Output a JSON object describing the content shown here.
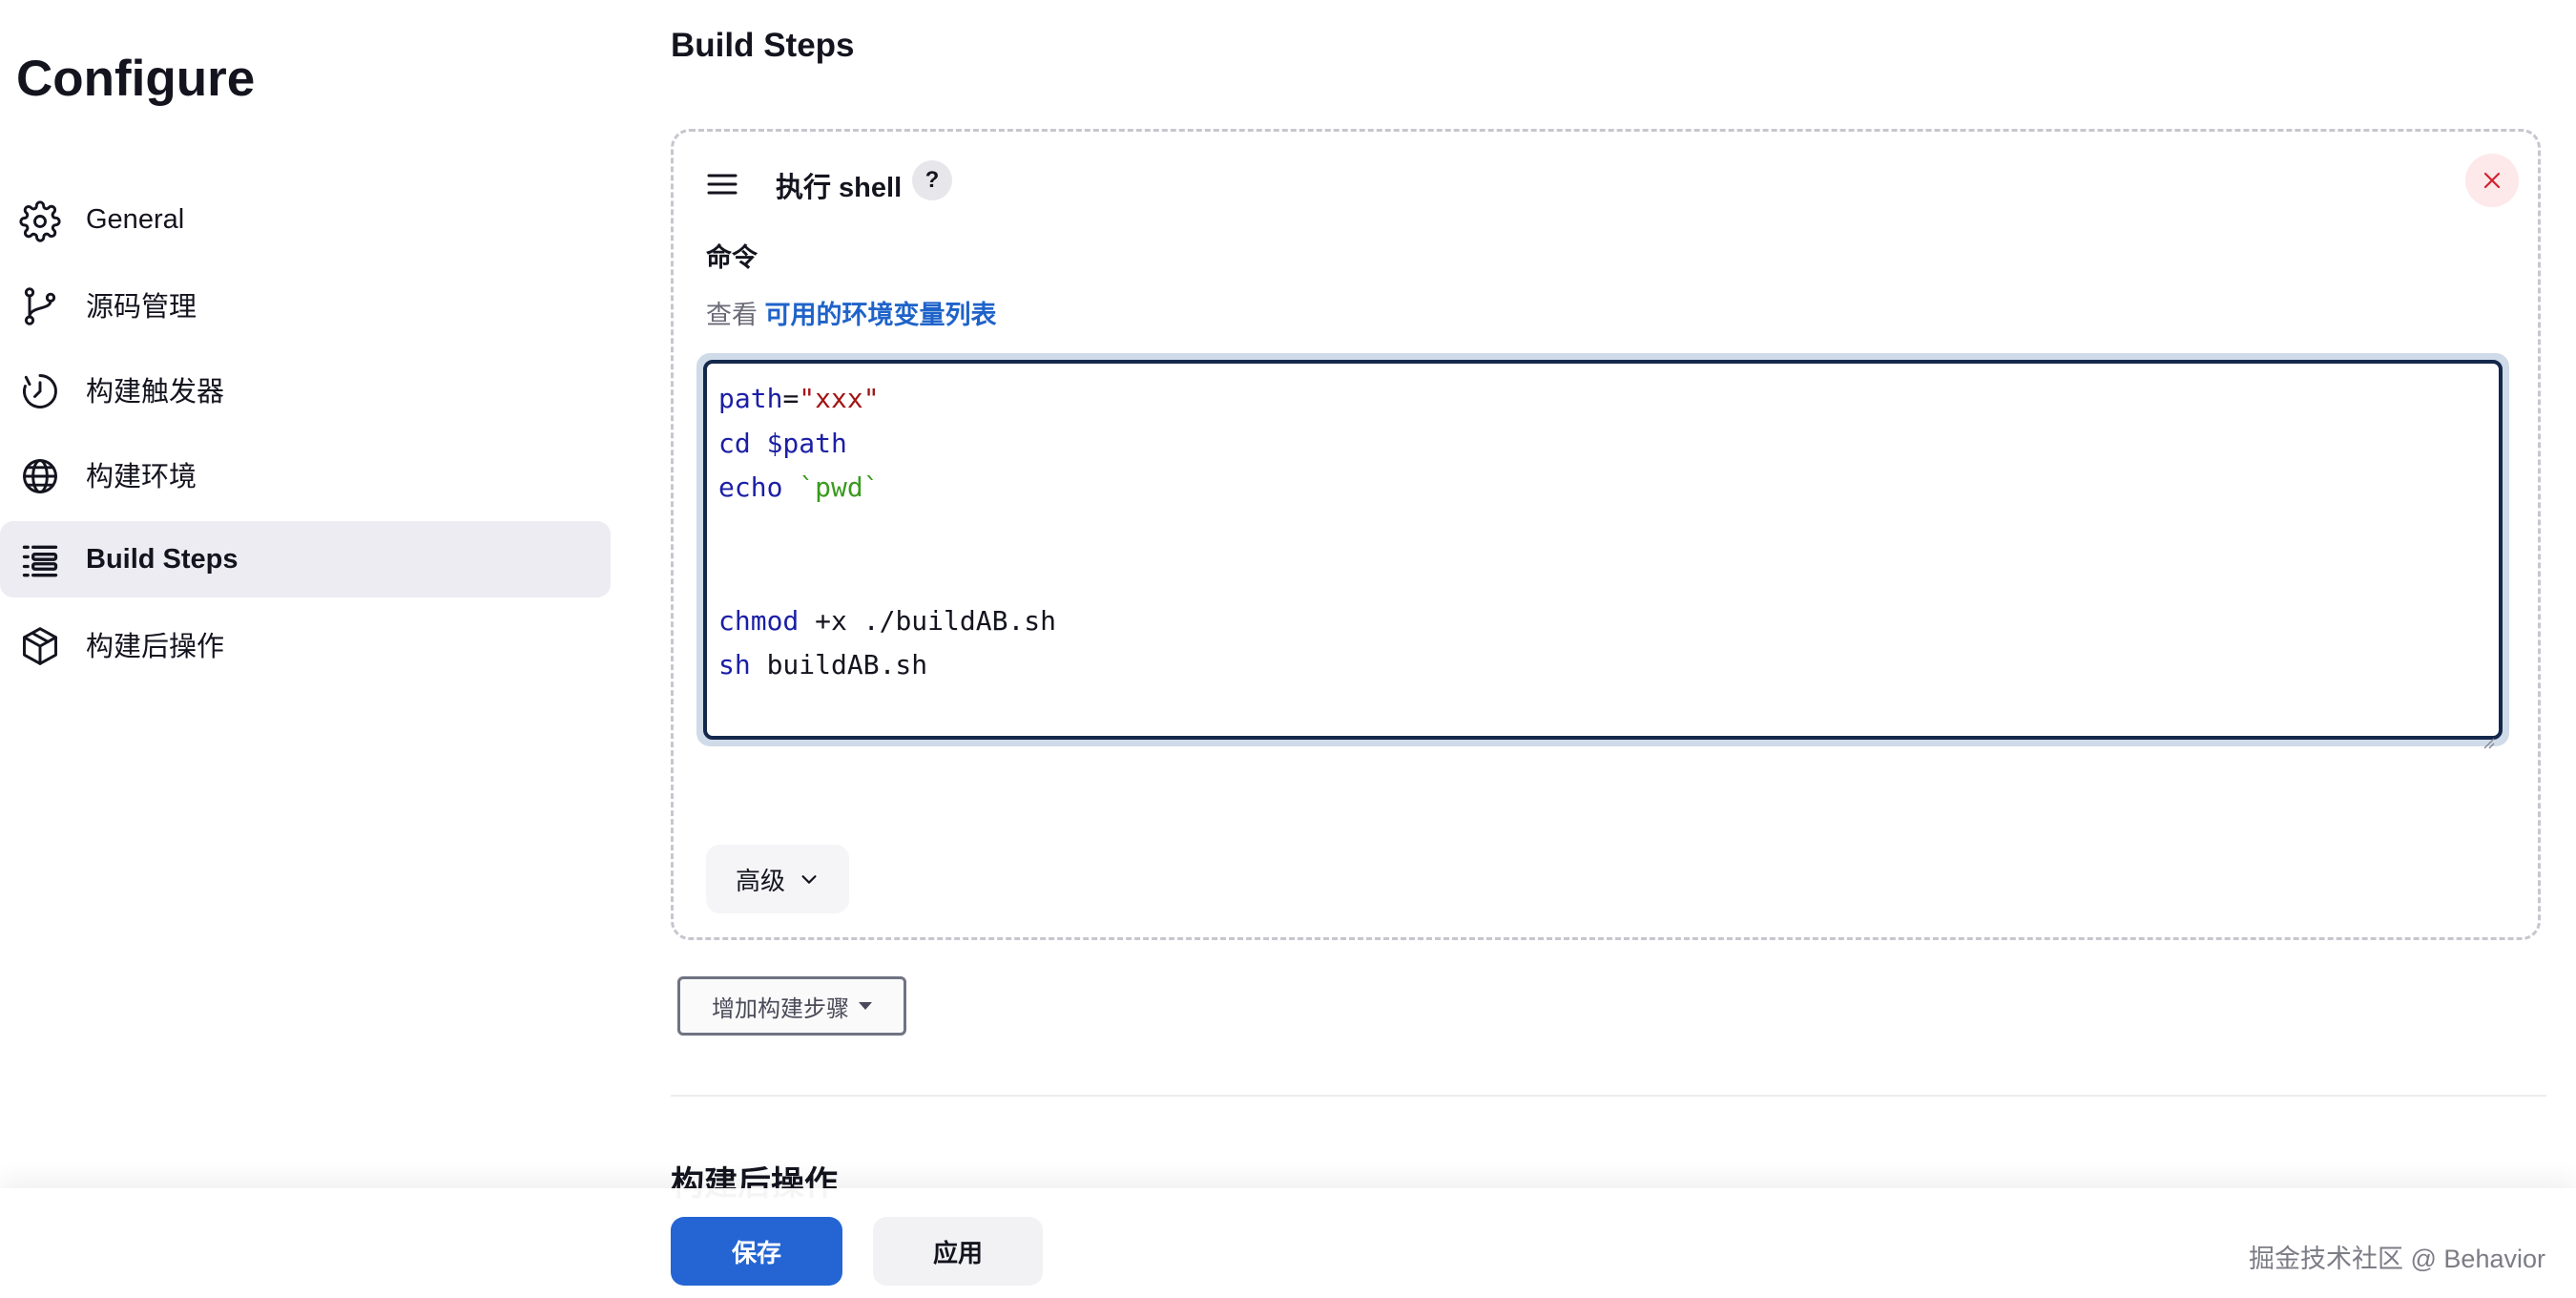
{
  "page_title": "Configure",
  "sidebar": {
    "items": [
      {
        "label": "General",
        "icon": "gear-icon",
        "active": false
      },
      {
        "label": "源码管理",
        "icon": "branch-icon",
        "active": false
      },
      {
        "label": "构建触发器",
        "icon": "clock-icon",
        "active": false
      },
      {
        "label": "构建环境",
        "icon": "globe-icon",
        "active": false
      },
      {
        "label": "Build Steps",
        "icon": "list-icon",
        "active": true
      },
      {
        "label": "构建后操作",
        "icon": "package-icon",
        "active": false
      }
    ]
  },
  "main": {
    "section_title": "Build Steps",
    "step": {
      "title": "执行 shell",
      "help": "?",
      "field_label": "命令",
      "env_prefix": "查看",
      "env_link": "可用的环境变量列表",
      "code": {
        "line1_kw": "path",
        "line1_eq": "=",
        "line1_str": "\"xxx\"",
        "line2_kw": "cd",
        "line2_var": " $path",
        "line3_kw": "echo",
        "line3_tick": " `pwd`",
        "line6_kw": "chmod",
        "line6_rest": " +x ./buildAB.sh",
        "line7_kw": "sh",
        "line7_rest": " buildAB.sh"
      },
      "advanced_label": "高级"
    },
    "add_step_label": "增加构建步骤",
    "post_build_title": "构建后操作"
  },
  "footer": {
    "save_label": "保存",
    "apply_label": "应用",
    "watermark": "掘金技术社区 @ Behavior"
  },
  "colors": {
    "accent": "#2465d3",
    "link": "#1f63c9",
    "active_nav_bg": "#ececf2",
    "code_keyword": "#1b1fa5",
    "code_string": "#a31515",
    "code_backtick": "#3b9a1f"
  }
}
